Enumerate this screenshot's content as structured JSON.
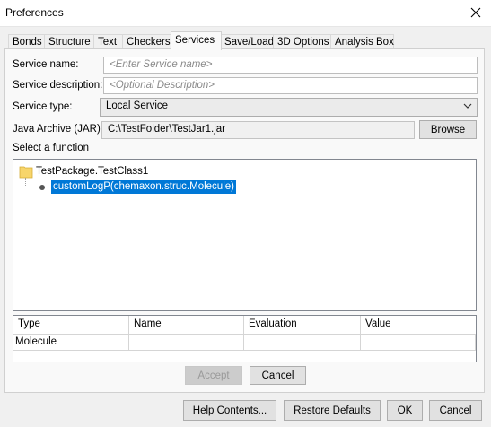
{
  "window": {
    "title": "Preferences"
  },
  "tabs": [
    {
      "label": "Bonds"
    },
    {
      "label": "Structure"
    },
    {
      "label": "Text"
    },
    {
      "label": "Checkers"
    },
    {
      "label": "Services"
    },
    {
      "label": "Save/Load"
    },
    {
      "label": "3D Options"
    },
    {
      "label": "Analysis Box"
    }
  ],
  "form": {
    "service_name_label": "Service name:",
    "service_name_placeholder": "<Enter Service name>",
    "service_desc_label": "Service description:",
    "service_desc_placeholder": "<Optional Description>",
    "service_type_label": "Service type:",
    "service_type_value": "Local Service",
    "jar_label": "Java Archive (JAR):",
    "jar_value": "C:\\TestFolder\\TestJar1.jar",
    "browse_label": "Browse",
    "select_function_label": "Select a function"
  },
  "tree": {
    "root_label": "TestPackage.TestClass1",
    "child_label": "customLogP(chemaxon.struc.Molecule)"
  },
  "table": {
    "headers": [
      "Type",
      "Name",
      "Evaluation",
      "Value"
    ],
    "rows": [
      [
        "Molecule",
        "",
        "",
        ""
      ]
    ]
  },
  "panel_buttons": {
    "accept": "Accept",
    "cancel": "Cancel"
  },
  "footer": {
    "help": "Help Contents...",
    "restore": "Restore Defaults",
    "ok": "OK",
    "cancel": "Cancel"
  },
  "colors": {
    "selection": "#0078d7",
    "folder": "#f7d56b"
  }
}
